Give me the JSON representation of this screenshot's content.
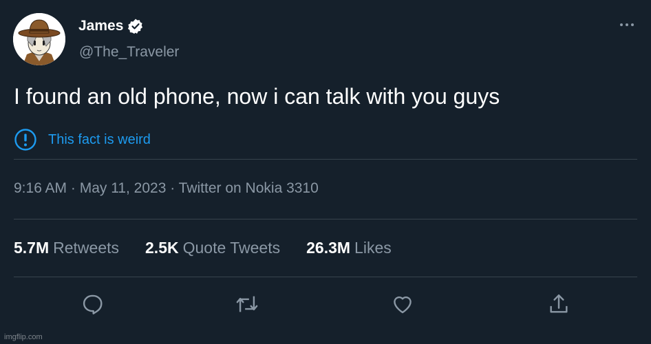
{
  "user": {
    "name": "James",
    "handle": "@The_Traveler"
  },
  "tweet": {
    "text": "I found an old phone, now i can talk with you guys"
  },
  "notice": {
    "label": "This fact is weird"
  },
  "meta": {
    "timestamp": "9:16 AM · May 11, 2023 · Twitter on Nokia 3310"
  },
  "stats": {
    "retweets": {
      "count": "5.7M",
      "label": "Retweets"
    },
    "quotes": {
      "count": "2.5K",
      "label": "Quote Tweets"
    },
    "likes": {
      "count": "26.3M",
      "label": "Likes"
    }
  },
  "actions": [
    "reply-icon",
    "retweet-icon",
    "like-icon",
    "share-icon"
  ],
  "watermark": "imgflip.com",
  "colors": {
    "background": "#15202b",
    "text": "#ffffff",
    "muted": "#8b98a5",
    "accent": "#1d9bf0",
    "divider": "#38444d"
  }
}
